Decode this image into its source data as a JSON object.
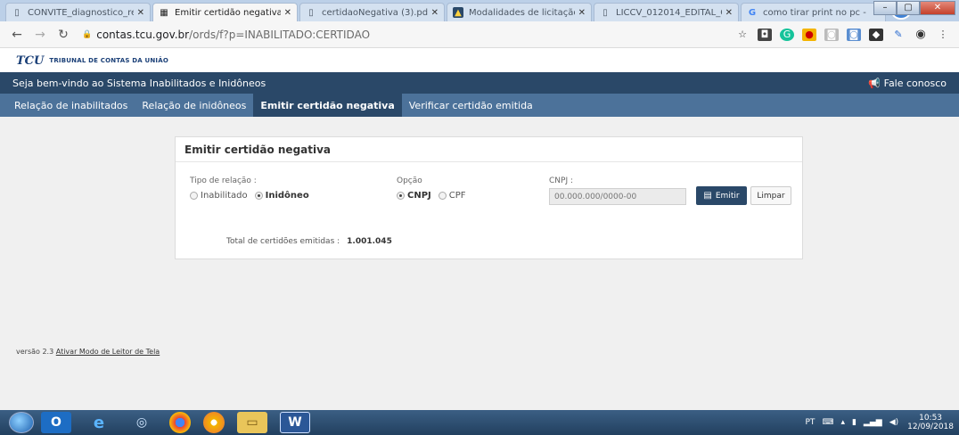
{
  "browser": {
    "tabs": [
      {
        "title": "CONVITE_diagnostico_re",
        "icon": "doc",
        "active": false
      },
      {
        "title": "Emitir certidão negativa",
        "icon": "page",
        "active": true
      },
      {
        "title": "certidaoNegativa (3).pdf",
        "icon": "doc",
        "active": false
      },
      {
        "title": "Modalidades de licitação",
        "icon": "site",
        "active": false
      },
      {
        "title": "LICCV_012014_EDITAL_C",
        "icon": "doc",
        "active": false
      },
      {
        "title": "como tirar print no pc -",
        "icon": "google",
        "active": false
      }
    ],
    "url_host": "contas.tcu.gov.br",
    "url_path": "/ords/f?p=INABILITADO:CERTIDAO"
  },
  "site": {
    "logo": "TCU",
    "org_name": "TRIBUNAL DE CONTAS DA UNIÃO",
    "welcome": "Seja bem-vindo ao Sistema Inabilitados e Inidôneos",
    "contact": "Fale conosco"
  },
  "nav": {
    "items": [
      {
        "label": "Relação de inabilitados",
        "active": false
      },
      {
        "label": "Relação de inidôneos",
        "active": false
      },
      {
        "label": "Emitir certidão negativa",
        "active": true
      },
      {
        "label": "Verificar certidão emitida",
        "active": false
      }
    ]
  },
  "form": {
    "title": "Emitir certidão negativa",
    "relation_label": "Tipo de relação :",
    "relation_options": [
      "Inabilitado",
      "Inidôneo"
    ],
    "relation_selected": "Inidôneo",
    "option_label": "Opção",
    "option_options": [
      "CNPJ",
      "CPF"
    ],
    "option_selected": "CNPJ",
    "cnpj_label": "CNPJ :",
    "cnpj_placeholder": "00.000.000/0000-00",
    "emit_label": "Emitir",
    "clear_label": "Limpar",
    "total_label": "Total de certidões emitidas :",
    "total_value": "1.001.045"
  },
  "footer": {
    "version": "versão 2.3",
    "screen_reader_link": "Ativar Modo de Leitor de Tela"
  },
  "taskbar": {
    "lang": "PT",
    "time": "10:53",
    "date": "12/09/2018"
  }
}
